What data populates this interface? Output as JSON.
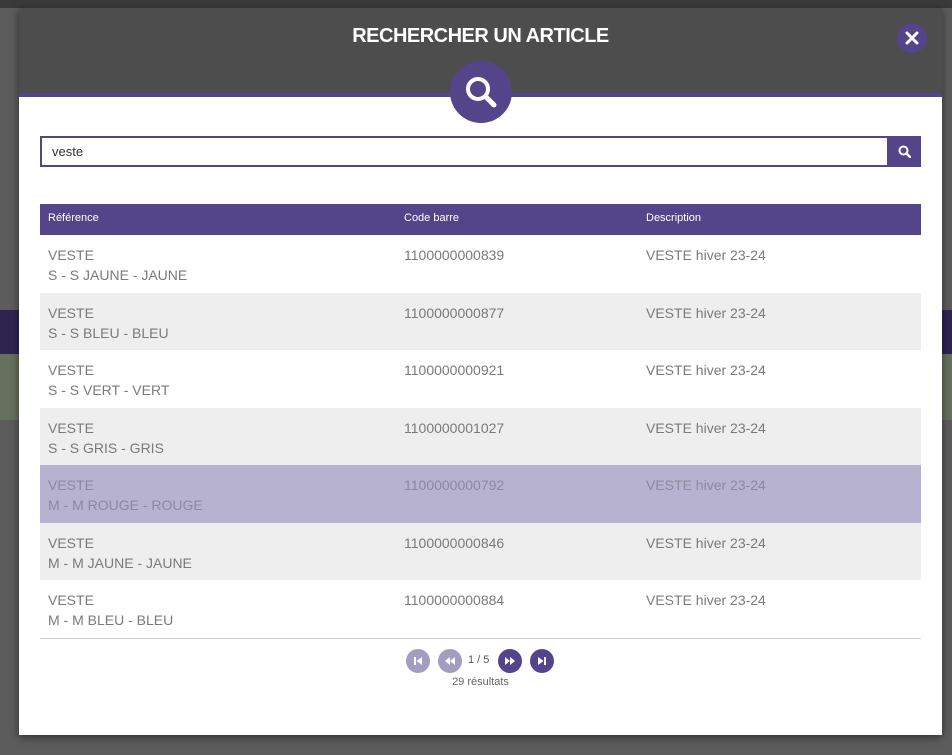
{
  "modal": {
    "title": "RECHERCHER UN ARTICLE"
  },
  "search": {
    "value": "veste"
  },
  "table": {
    "headers": [
      "Référence",
      "Code barre",
      "Description"
    ],
    "rows": [
      {
        "ref_line1": "VESTE",
        "ref_line2": "S - S JAUNE - JAUNE",
        "barcode": "1100000000839",
        "description": "VESTE hiver 23-24"
      },
      {
        "ref_line1": "VESTE",
        "ref_line2": "S - S BLEU - BLEU",
        "barcode": "1100000000877",
        "description": "VESTE hiver 23-24"
      },
      {
        "ref_line1": "VESTE",
        "ref_line2": "S - S VERT - VERT",
        "barcode": "1100000000921",
        "description": "VESTE hiver 23-24"
      },
      {
        "ref_line1": "VESTE",
        "ref_line2": "S - S GRIS - GRIS",
        "barcode": "1100000001027",
        "description": "VESTE hiver 23-24"
      },
      {
        "ref_line1": "VESTE",
        "ref_line2": "M - M ROUGE - ROUGE",
        "barcode": "1100000000792",
        "description": "VESTE hiver 23-24"
      },
      {
        "ref_line1": "VESTE",
        "ref_line2": "M - M JAUNE - JAUNE",
        "barcode": "1100000000846",
        "description": "VESTE hiver 23-24"
      },
      {
        "ref_line1": "VESTE",
        "ref_line2": "M - M BLEU - BLEU",
        "barcode": "1100000000884",
        "description": "VESTE hiver 23-24"
      }
    ],
    "selected_row": 4
  },
  "pagination": {
    "page_info": "1 / 5",
    "result_count": "29 résultats"
  },
  "icons": {
    "close": "close-icon",
    "header": "magnifier-icon",
    "search": "search-icon",
    "first": "first-page-icon",
    "prev": "previous-page-icon",
    "next": "next-page-icon",
    "last": "last-page-icon"
  },
  "colors": {
    "accent": "#54458a",
    "header_bg": "#4d4d4d",
    "selected_row": "#b7b2cf",
    "stripe_row": "#eeeeee",
    "disabled_button": "#a49dc2"
  }
}
